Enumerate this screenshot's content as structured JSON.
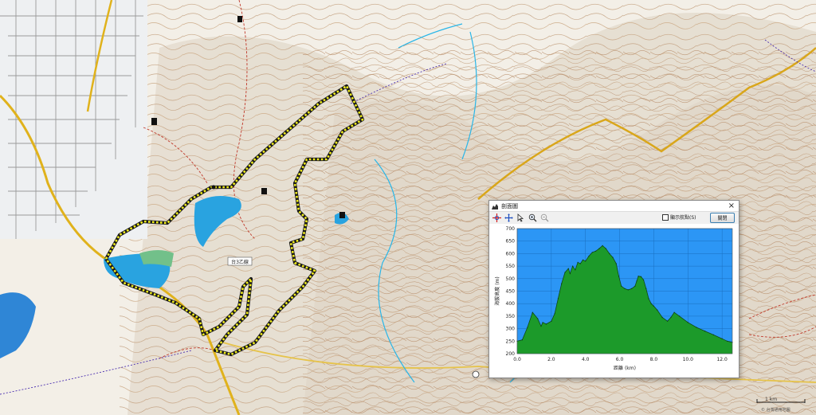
{
  "map": {
    "road_label": "台3乙線",
    "scale_text": "1 km",
    "copyright": "© 台灣通用地圖"
  },
  "dialog": {
    "title": "剖面圖",
    "close_glyph": "×",
    "tools": [
      "crosshair-icon",
      "move-icon",
      "cursor-icon",
      "zoom-in-icon",
      "zoom-out-icon"
    ],
    "checkbox_label": "顯示航點(S)",
    "close_button_label": "關閉"
  },
  "chart_data": {
    "type": "area",
    "xlabel": "距離 (km)",
    "ylabel": "海拔高度 (m)",
    "xlim": [
      0,
      12.6
    ],
    "ylim": [
      200,
      700
    ],
    "xticks": [
      "0.0",
      "2.0",
      "4.0",
      "6.0",
      "8.0",
      "10.0",
      "12.0"
    ],
    "yticks": [
      "200",
      "250",
      "300",
      "350",
      "400",
      "450",
      "500",
      "550",
      "600",
      "650",
      "700"
    ],
    "grid": true,
    "background": "#2c96f5",
    "fill": "#1c9a2a",
    "x": [
      0,
      0.3,
      0.6,
      0.9,
      1.2,
      1.4,
      1.5,
      1.7,
      2.0,
      2.2,
      2.4,
      2.6,
      2.8,
      3.0,
      3.1,
      3.25,
      3.4,
      3.55,
      3.7,
      3.85,
      4.0,
      4.2,
      4.4,
      4.6,
      4.8,
      5.0,
      5.2,
      5.4,
      5.6,
      5.8,
      5.95,
      6.1,
      6.3,
      6.5,
      6.7,
      6.9,
      7.0,
      7.1,
      7.25,
      7.4,
      7.55,
      7.7,
      7.85,
      8.0,
      8.2,
      8.5,
      8.8,
      9.0,
      9.2,
      9.5,
      10.0,
      10.5,
      11.0,
      11.5,
      12.0,
      12.3,
      12.6
    ],
    "y": [
      250,
      255,
      305,
      365,
      340,
      310,
      325,
      318,
      330,
      360,
      420,
      480,
      525,
      540,
      520,
      550,
      535,
      565,
      560,
      575,
      570,
      590,
      605,
      610,
      620,
      632,
      620,
      600,
      585,
      560,
      510,
      470,
      460,
      455,
      460,
      470,
      490,
      510,
      508,
      495,
      460,
      420,
      400,
      390,
      375,
      345,
      330,
      345,
      365,
      350,
      325,
      305,
      290,
      275,
      260,
      250,
      245
    ]
  }
}
